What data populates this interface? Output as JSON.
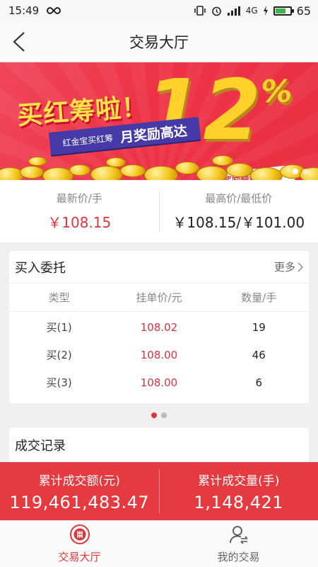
{
  "status": {
    "time": "15:49",
    "network": "4G",
    "battery": "65"
  },
  "nav": {
    "title": "交易大厅"
  },
  "banner": {
    "headline": "买红筹啦！",
    "percent": "12",
    "percent_sign": "%",
    "ribbon_small": "红金宝买红筹",
    "ribbon_big": "月奖励高达",
    "tag": "奖励翻番赚不停！"
  },
  "prices": {
    "latest_label": "最新价/手",
    "latest_value": "￥108.15",
    "range_label": "最高价/最低价",
    "range_value": "￥108.15/￥101.00"
  },
  "buy": {
    "title": "买入委托",
    "more": "更多",
    "columns": [
      "类型",
      "挂单价/元",
      "数量/手"
    ],
    "rows": [
      {
        "type": "买(1)",
        "price": "108.02",
        "qty": "19"
      },
      {
        "type": "买(2)",
        "price": "108.00",
        "qty": "46"
      },
      {
        "type": "买(3)",
        "price": "108.00",
        "qty": "6"
      }
    ]
  },
  "trade": {
    "title": "成交记录"
  },
  "summary": {
    "amount_label": "累计成交额(元)",
    "amount_value": "119,461,483.47",
    "volume_label": "累计成交量(手)",
    "volume_value": "1,148,421"
  },
  "tabs": [
    {
      "label": "交易大厅",
      "icon": "trade-hall-icon",
      "active": true
    },
    {
      "label": "我的交易",
      "icon": "user-trade-icon",
      "active": false
    }
  ],
  "colors": {
    "accent": "#e0363a",
    "summary_bg": "#e53a3f"
  }
}
